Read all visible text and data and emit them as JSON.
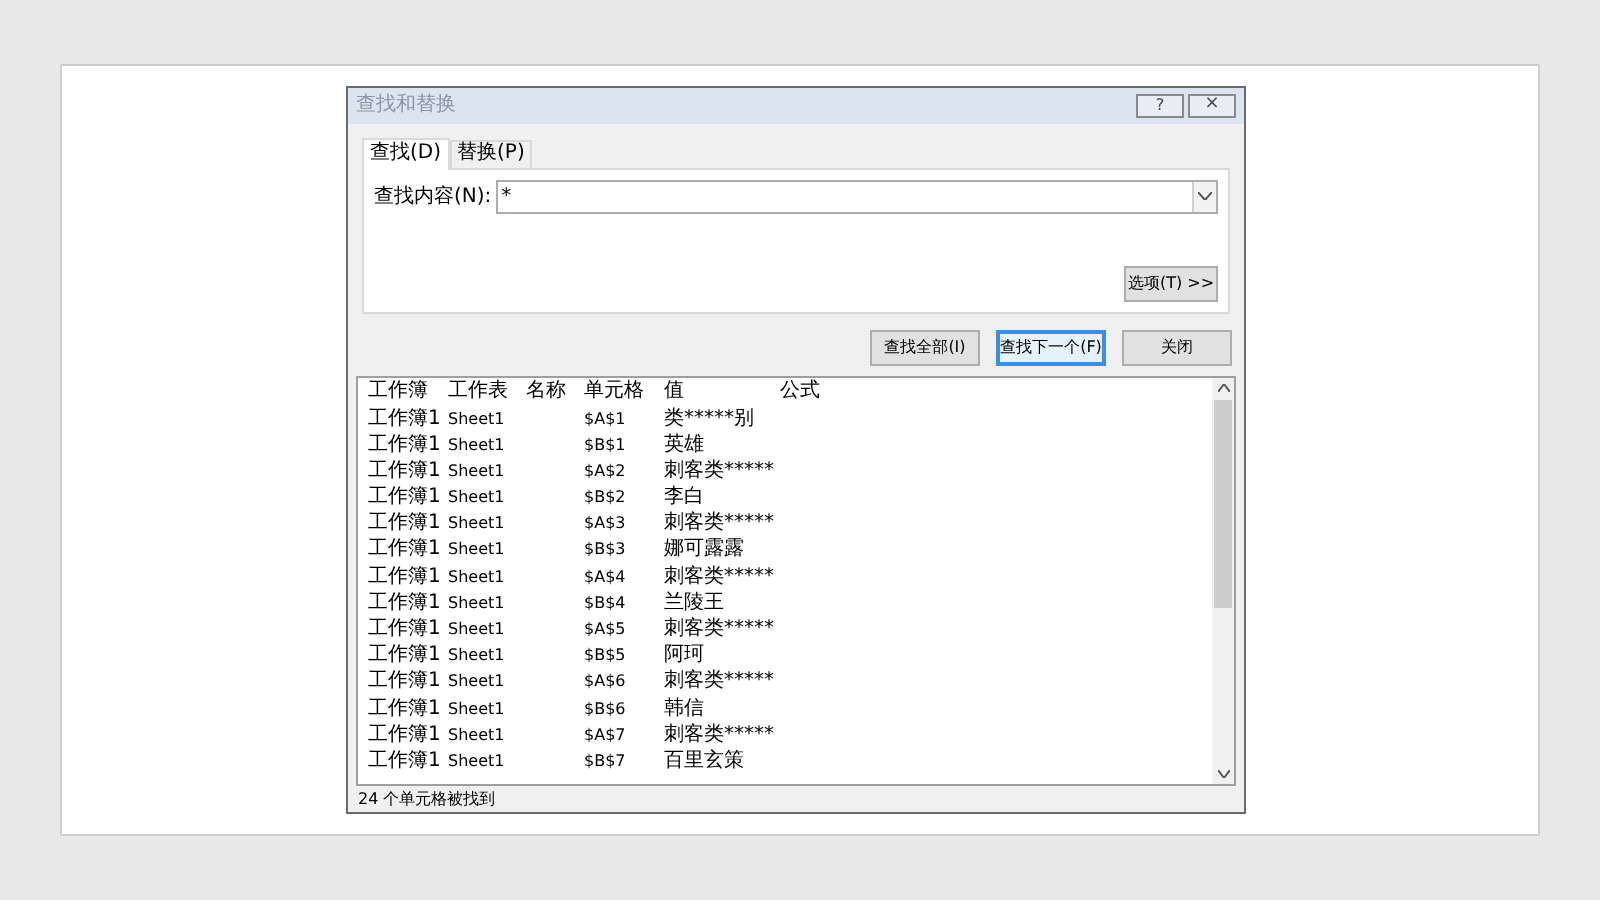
{
  "window": {
    "title": "查找和替换",
    "help_button": "?",
    "close_button": "×"
  },
  "tabs": [
    {
      "label": "查找(D)",
      "selected": true
    },
    {
      "label": "替换(P)",
      "selected": false
    }
  ],
  "find_field": {
    "label": "查找内容(N):",
    "value": "*"
  },
  "options_button": "选项(T) >>",
  "buttons": [
    {
      "label": "查找全部(I)",
      "focused": false
    },
    {
      "label": "查找下一个(F)",
      "focused": true
    },
    {
      "label": "关闭",
      "focused": false
    }
  ],
  "results": {
    "columns": [
      "工作簿",
      "工作表",
      "名称",
      "单元格",
      "值",
      "公式"
    ],
    "rows": [
      [
        "工作簿1",
        "Sheet1",
        "",
        "$A$1",
        "类*****别",
        ""
      ],
      [
        "工作簿1",
        "Sheet1",
        "",
        "$B$1",
        "英雄",
        ""
      ],
      [
        "工作簿1",
        "Sheet1",
        "",
        "$A$2",
        "刺客类*****",
        ""
      ],
      [
        "工作簿1",
        "Sheet1",
        "",
        "$B$2",
        "李白",
        ""
      ],
      [
        "工作簿1",
        "Sheet1",
        "",
        "$A$3",
        "刺客类*****",
        ""
      ],
      [
        "工作簿1",
        "Sheet1",
        "",
        "$B$3",
        "娜可露露",
        ""
      ],
      [
        "工作簿1",
        "Sheet1",
        "",
        "$A$4",
        "刺客类*****",
        ""
      ],
      [
        "工作簿1",
        "Sheet1",
        "",
        "$B$4",
        "兰陵王",
        ""
      ],
      [
        "工作簿1",
        "Sheet1",
        "",
        "$A$5",
        "刺客类*****",
        ""
      ],
      [
        "工作簿1",
        "Sheet1",
        "",
        "$B$5",
        "阿珂",
        ""
      ],
      [
        "工作簿1",
        "Sheet1",
        "",
        "$A$6",
        "刺客类*****",
        ""
      ],
      [
        "工作簿1",
        "Sheet1",
        "",
        "$B$6",
        "韩信",
        ""
      ],
      [
        "工作簿1",
        "Sheet1",
        "",
        "$A$7",
        "刺客类*****",
        ""
      ],
      [
        "工作簿1",
        "Sheet1",
        "",
        "$B$7",
        "百里玄策",
        ""
      ]
    ]
  },
  "status_bar": "24 个单元格被找到"
}
